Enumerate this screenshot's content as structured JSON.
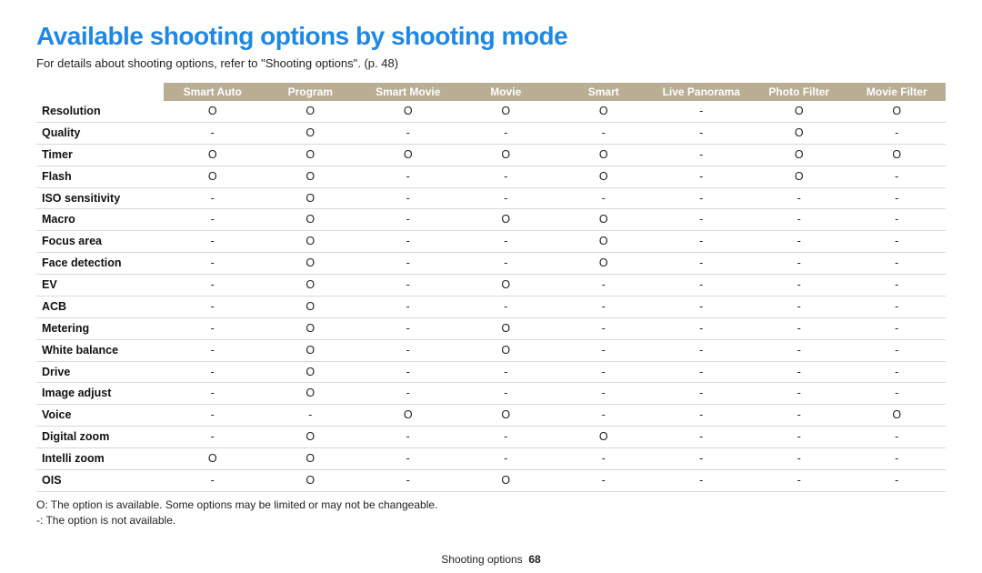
{
  "title": "Available shooting options by shooting mode",
  "subtitle": "For details about shooting options, refer to \"Shooting options\". (p. 48)",
  "legend_available": "O: The option is available. Some options may be limited or may not be changeable.",
  "legend_not_available": "-: The option is not available.",
  "footer_section": "Shooting options",
  "footer_page": "68",
  "symbols": {
    "yes": "O",
    "no": "-"
  },
  "columns": [
    "Smart Auto",
    "Program",
    "Smart Movie",
    "Movie",
    "Smart",
    "Live Panorama",
    "Photo Filter",
    "Movie Filter"
  ],
  "chart_data": {
    "type": "table",
    "title": "Available shooting options by shooting mode",
    "columns": [
      "Smart Auto",
      "Program",
      "Smart Movie",
      "Movie",
      "Smart",
      "Live Panorama",
      "Photo Filter",
      "Movie Filter"
    ],
    "legend": {
      "O": "available",
      "-": "not available"
    },
    "rows": [
      {
        "label": "Resolution",
        "values": [
          "O",
          "O",
          "O",
          "O",
          "O",
          "-",
          "O",
          "O"
        ]
      },
      {
        "label": "Quality",
        "values": [
          "-",
          "O",
          "-",
          "-",
          "-",
          "-",
          "O",
          "-"
        ]
      },
      {
        "label": "Timer",
        "values": [
          "O",
          "O",
          "O",
          "O",
          "O",
          "-",
          "O",
          "O"
        ]
      },
      {
        "label": "Flash",
        "values": [
          "O",
          "O",
          "-",
          "-",
          "O",
          "-",
          "O",
          "-"
        ]
      },
      {
        "label": "ISO sensitivity",
        "values": [
          "-",
          "O",
          "-",
          "-",
          "-",
          "-",
          "-",
          "-"
        ]
      },
      {
        "label": "Macro",
        "values": [
          "-",
          "O",
          "-",
          "O",
          "O",
          "-",
          "-",
          "-"
        ]
      },
      {
        "label": "Focus area",
        "values": [
          "-",
          "O",
          "-",
          "-",
          "O",
          "-",
          "-",
          "-"
        ]
      },
      {
        "label": "Face detection",
        "values": [
          "-",
          "O",
          "-",
          "-",
          "O",
          "-",
          "-",
          "-"
        ]
      },
      {
        "label": "EV",
        "values": [
          "-",
          "O",
          "-",
          "O",
          "-",
          "-",
          "-",
          "-"
        ]
      },
      {
        "label": "ACB",
        "values": [
          "-",
          "O",
          "-",
          "-",
          "-",
          "-",
          "-",
          "-"
        ]
      },
      {
        "label": "Metering",
        "values": [
          "-",
          "O",
          "-",
          "O",
          "-",
          "-",
          "-",
          "-"
        ]
      },
      {
        "label": "White balance",
        "values": [
          "-",
          "O",
          "-",
          "O",
          "-",
          "-",
          "-",
          "-"
        ]
      },
      {
        "label": "Drive",
        "values": [
          "-",
          "O",
          "-",
          "-",
          "-",
          "-",
          "-",
          "-"
        ]
      },
      {
        "label": "Image adjust",
        "values": [
          "-",
          "O",
          "-",
          "-",
          "-",
          "-",
          "-",
          "-"
        ]
      },
      {
        "label": "Voice",
        "values": [
          "-",
          "-",
          "O",
          "O",
          "-",
          "-",
          "-",
          "O"
        ]
      },
      {
        "label": "Digital zoom",
        "values": [
          "-",
          "O",
          "-",
          "-",
          "O",
          "-",
          "-",
          "-"
        ]
      },
      {
        "label": "Intelli zoom",
        "values": [
          "O",
          "O",
          "-",
          "-",
          "-",
          "-",
          "-",
          "-"
        ]
      },
      {
        "label": "OIS",
        "values": [
          "-",
          "O",
          "-",
          "O",
          "-",
          "-",
          "-",
          "-"
        ]
      }
    ]
  }
}
